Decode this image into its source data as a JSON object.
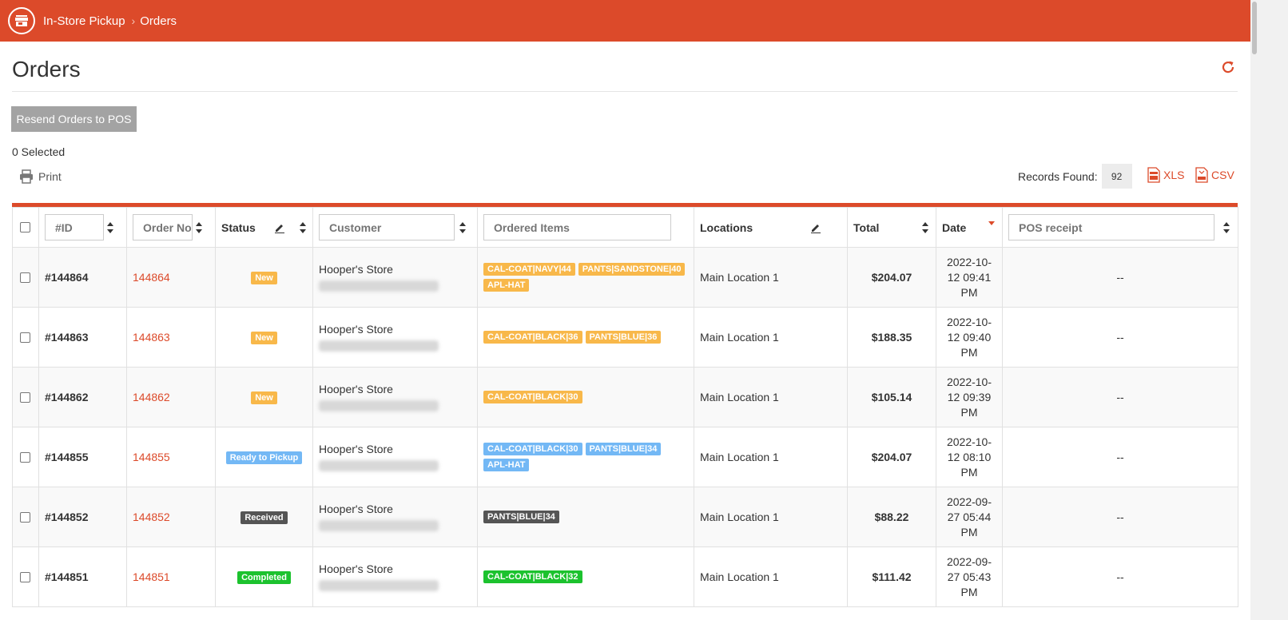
{
  "header": {
    "logo_icon": "store-icon",
    "breadcrumb": [
      "In-Store Pickup",
      "Orders"
    ],
    "color": "#dc4a2a"
  },
  "page": {
    "title": "Orders",
    "resend_button": "Resend Orders to POS",
    "selected_text": "0 Selected",
    "print_label": "Print",
    "records_label": "Records Found:",
    "records_count": "92",
    "export_xls": "XLS",
    "export_csv": "CSV"
  },
  "table": {
    "headers": {
      "id_placeholder": "#ID",
      "order_placeholder": "Order No",
      "status": "Status",
      "customer_placeholder": "Customer",
      "items_placeholder": "Ordered Items",
      "locations": "Locations",
      "total": "Total",
      "date": "Date",
      "pos_placeholder": "POS receipt"
    },
    "rows": [
      {
        "id": "#144864",
        "order": "144864",
        "status": "New",
        "status_color": "#f8b84a",
        "customer": "Hooper's Store",
        "items": [
          {
            "label": "CAL-COAT|NAVY|44",
            "color": "#f8b84a"
          },
          {
            "label": "PANTS|SANDSTONE|40",
            "color": "#f8b84a"
          },
          {
            "label": "APL-HAT",
            "color": "#f8b84a"
          }
        ],
        "location": "Main Location 1",
        "total": "$204.07",
        "date_line1": "2022-10-",
        "date_line2": "12 09:41",
        "date_line3": "PM",
        "pos": "--"
      },
      {
        "id": "#144863",
        "order": "144863",
        "status": "New",
        "status_color": "#f8b84a",
        "customer": "Hooper's Store",
        "items": [
          {
            "label": "CAL-COAT|BLACK|36",
            "color": "#f8b84a"
          },
          {
            "label": "PANTS|BLUE|36",
            "color": "#f8b84a"
          }
        ],
        "location": "Main Location 1",
        "total": "$188.35",
        "date_line1": "2022-10-",
        "date_line2": "12 09:40",
        "date_line3": "PM",
        "pos": "--"
      },
      {
        "id": "#144862",
        "order": "144862",
        "status": "New",
        "status_color": "#f8b84a",
        "customer": "Hooper's Store",
        "items": [
          {
            "label": "CAL-COAT|BLACK|30",
            "color": "#f8b84a"
          }
        ],
        "location": "Main Location 1",
        "total": "$105.14",
        "date_line1": "2022-10-",
        "date_line2": "12 09:39",
        "date_line3": "PM",
        "pos": "--"
      },
      {
        "id": "#144855",
        "order": "144855",
        "status": "Ready to Pickup",
        "status_color": "#73b8f5",
        "customer": "Hooper's Store",
        "items": [
          {
            "label": "CAL-COAT|BLACK|30",
            "color": "#73b8f5"
          },
          {
            "label": "PANTS|BLUE|34",
            "color": "#73b8f5"
          },
          {
            "label": "APL-HAT",
            "color": "#73b8f5"
          }
        ],
        "location": "Main Location 1",
        "total": "$204.07",
        "date_line1": "2022-10-",
        "date_line2": "12 08:10",
        "date_line3": "PM",
        "pos": "--"
      },
      {
        "id": "#144852",
        "order": "144852",
        "status": "Received",
        "status_color": "#555555",
        "customer": "Hooper's Store",
        "items": [
          {
            "label": "PANTS|BLUE|34",
            "color": "#555555"
          }
        ],
        "location": "Main Location 1",
        "total": "$88.22",
        "date_line1": "2022-09-",
        "date_line2": "27 05:44",
        "date_line3": "PM",
        "pos": "--"
      },
      {
        "id": "#144851",
        "order": "144851",
        "status": "Completed",
        "status_color": "#1cc22e",
        "customer": "Hooper's Store",
        "items": [
          {
            "label": "CAL-COAT|BLACK|32",
            "color": "#1cc22e"
          }
        ],
        "location": "Main Location 1",
        "total": "$111.42",
        "date_line1": "2022-09-",
        "date_line2": "27 05:43",
        "date_line3": "PM",
        "pos": "--"
      }
    ]
  }
}
